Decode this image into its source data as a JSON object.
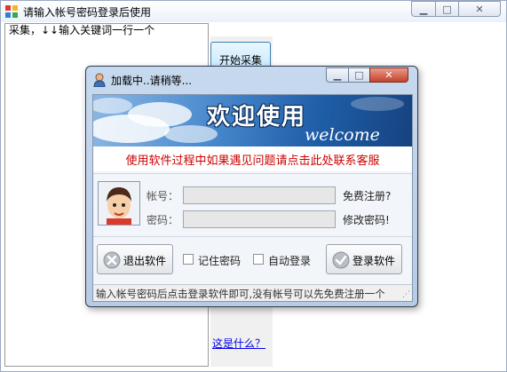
{
  "main_window": {
    "title": "请输入帐号密码登录后使用",
    "hint": "采集，↓↓输入关键词一行一个",
    "start_button": "开始采集",
    "help_link": "这是什么？"
  },
  "dialog": {
    "title": "加载中..请稍等...",
    "banner_title": "欢迎使用",
    "banner_subtitle": "welcome",
    "notice": "使用软件过程中如果遇见问题请点击此处联系客服",
    "account_label": "帐号：",
    "password_label": "密码：",
    "account_value": "",
    "password_value": "",
    "register_link": "免费注册?",
    "change_password_link": "修改密码!",
    "exit_button": "退出软件",
    "remember_label": "记住密码",
    "auto_login_label": "自动登录",
    "login_button": "登录软件",
    "status": "输入帐号密码后点击登录软件即可,没有帐号可以先免费注册一个"
  },
  "colors": {
    "notice_red": "#cc0000",
    "link_blue": "#0000ee",
    "banner_blue": "#1f5ea8"
  },
  "icons": [
    "app-icon",
    "user-icon",
    "minimize-icon",
    "maximize-icon",
    "close-icon",
    "exit-icon",
    "login-check-icon",
    "avatar"
  ]
}
